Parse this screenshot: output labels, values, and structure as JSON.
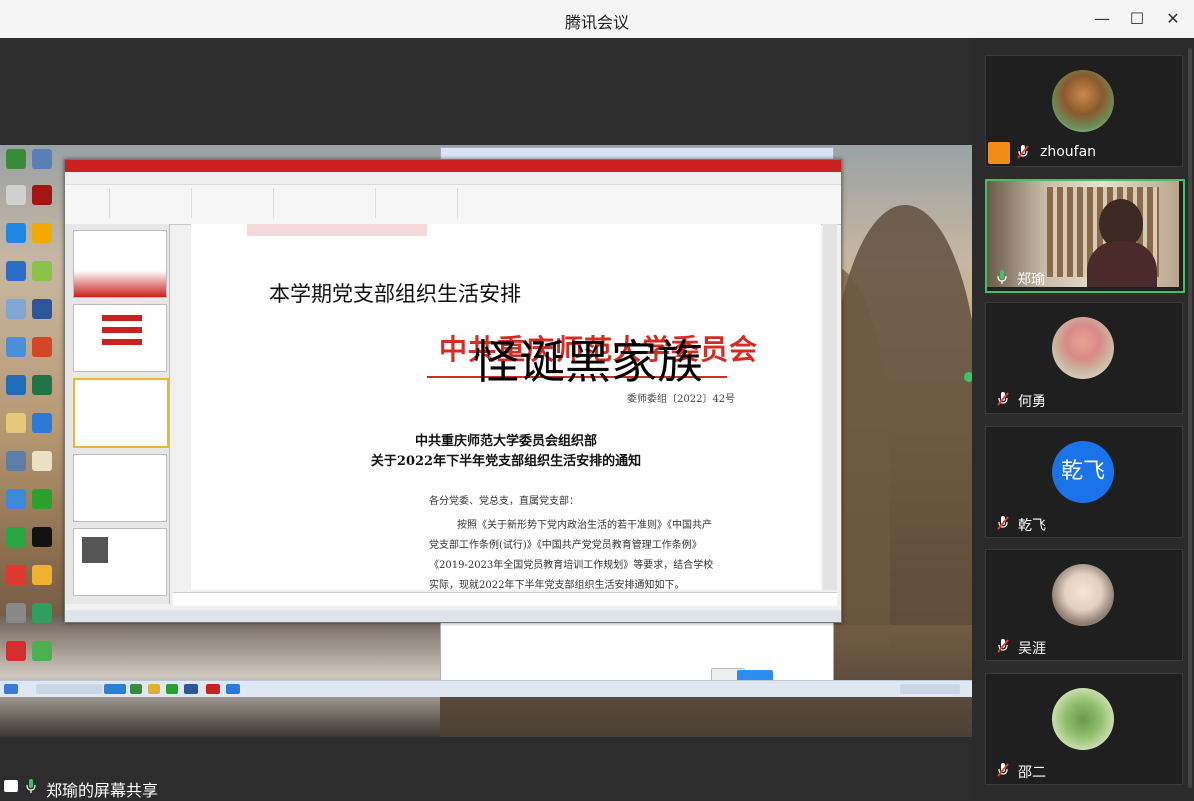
{
  "app": {
    "title": "腾讯会议"
  },
  "window_controls": {
    "minimize": "—",
    "maximize": "☐",
    "close": "✕"
  },
  "shared_screen": {
    "slide": {
      "heading": "本学期党支部组织生活安排",
      "red_header": "中共重庆师范大学委员会",
      "overlay_text": "怪诞黑家族",
      "doc_number": "委师委组〔2022〕42号",
      "org_line1": "中共重庆师范大学委员会组织部",
      "org_line2": "关于2022年下半年党支部组织生活安排的通知",
      "body_lines": [
        "各分党委、党总支，直属党支部：",
        "按照《关于新形势下党内政治生活的若干准则》《中国共产",
        "党支部工作条例(试行)》《中国共产党党员教育管理工作条例》",
        "《2019-2023年全国党员教育培训工作规划》等要求，结合学校",
        "实际，现就2022年下半年党支部组织生活安排通知如下。"
      ]
    }
  },
  "share_status": {
    "label": "郑瑜的屏幕共享",
    "mic_icon": "microphone-icon"
  },
  "participants": [
    {
      "name": "zhoufan",
      "muted": true,
      "host": true
    },
    {
      "name": "郑瑜",
      "muted": false,
      "speaking": true
    },
    {
      "name": "何勇",
      "muted": true
    },
    {
      "name": "乾飞",
      "muted": true,
      "avatar_text": "乾飞",
      "avatar_color": "#1a73e8"
    },
    {
      "name": "吴涯",
      "muted": true
    },
    {
      "name": "邵二",
      "muted": true
    }
  ],
  "colors": {
    "accent": "#42c165",
    "ppt_red": "#c9211e",
    "muted_red": "#e0442b"
  }
}
